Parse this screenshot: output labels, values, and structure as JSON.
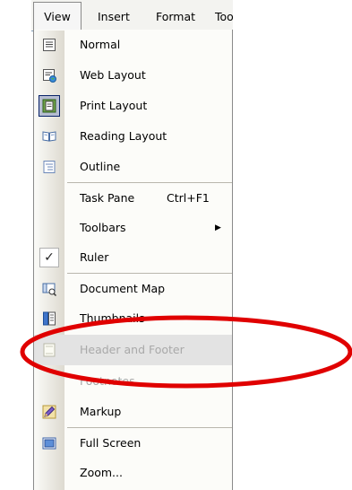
{
  "menubar": {
    "view": "View",
    "insert": "Insert",
    "format": "Format",
    "tools": "Too"
  },
  "menu": {
    "normal": "Normal",
    "web_layout": "Web Layout",
    "print_layout": "Print Layout",
    "reading_layout": "Reading Layout",
    "outline": "Outline",
    "task_pane": "Task Pane",
    "task_pane_shortcut": "Ctrl+F1",
    "toolbars": "Toolbars",
    "ruler": "Ruler",
    "document_map": "Document Map",
    "thumbnails": "Thumbnails",
    "header_footer": "Header and Footer",
    "footnotes": "Footnotes",
    "markup": "Markup",
    "full_screen": "Full Screen",
    "zoom": "Zoom..."
  },
  "annotation_color": "#e00000"
}
